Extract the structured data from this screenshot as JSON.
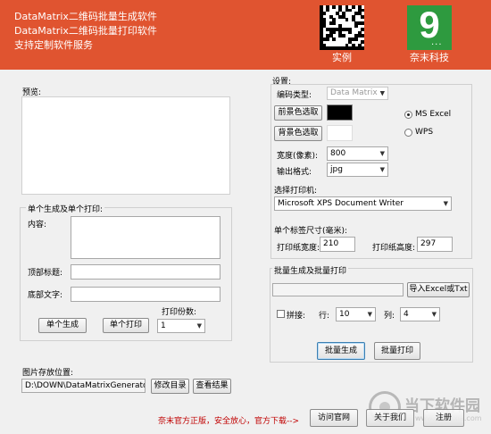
{
  "header": {
    "line1": "DataMatrix二维码批量生成软件",
    "line2": "DataMatrix二维码批量打印软件",
    "line3": "支持定制软件服务",
    "example_caption": "实例",
    "company_caption": "奈末科技",
    "logo_glyph": "9",
    "logo_dots": "...",
    "header_color": "#e05430",
    "logo_color": "#2e9a3f"
  },
  "preview": {
    "label": "预览:"
  },
  "single": {
    "title": "单个生成及单个打印:",
    "content_label": "内容:",
    "top_title_label": "顶部标题:",
    "bottom_text_label": "底部文字:",
    "copies_label": "打印份数:",
    "copies_value": "1",
    "generate_button": "单个生成",
    "print_button": "单个打印"
  },
  "settings": {
    "title": "设置:",
    "encoding_label": "编码类型:",
    "encoding_value": "Data Matrix",
    "fg_button": "前景色选取",
    "bg_button": "背景色选取",
    "fg_color": "#000000",
    "bg_color": "#ffffff",
    "ms_excel_label": "MS  Excel",
    "wps_label": "WPS",
    "width_label": "宽度(像素):",
    "width_value": "800",
    "format_label": "输出格式:",
    "format_value": "jpg",
    "printer_label": "选择打印机:",
    "printer_value": "Microsoft XPS Document Writer",
    "label_size_label": "单个标签尺寸(毫米):",
    "paper_width_label": "打印纸宽度:",
    "paper_width_value": "210",
    "paper_height_label": "打印纸高度:",
    "paper_height_value": "297"
  },
  "batch": {
    "title": "批量生成及批量打印",
    "import_button": "导入Excel或Txt",
    "concat_label": "拼接:",
    "row_label": "行:",
    "row_value": "10",
    "col_label": "列:",
    "col_value": "4",
    "generate_button": "批量生成",
    "print_button": "批量打印"
  },
  "storage": {
    "label": "图片存放位置:",
    "path": "D:\\DOWN\\DataMatrixGenerator",
    "change_button": "修改目录",
    "view_button": "查看结果"
  },
  "footer": {
    "message": "奈末官方正版，安全放心，官方下载-->",
    "visit_button": "访问官网",
    "about_button": "关于我们",
    "register_button": "注册"
  },
  "watermark": {
    "title": "当下软件园",
    "subtitle": "www.downxia.com"
  }
}
